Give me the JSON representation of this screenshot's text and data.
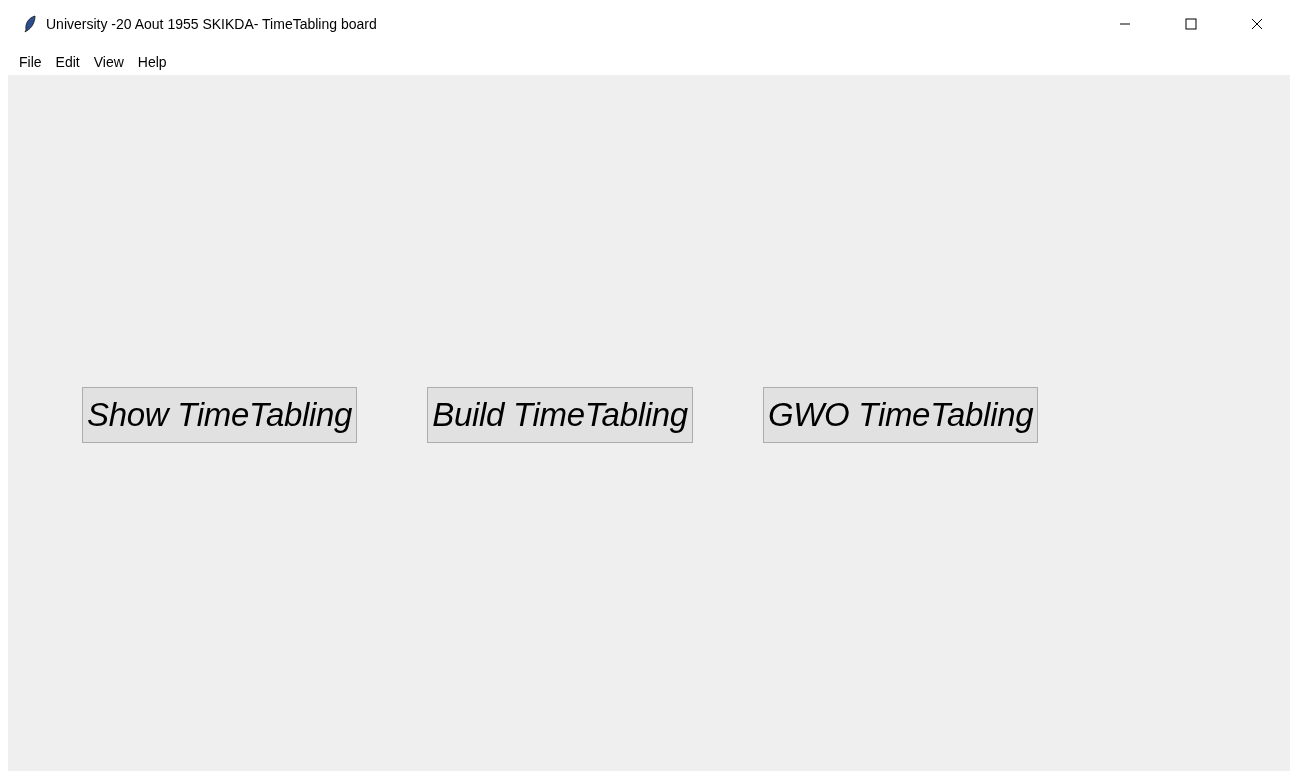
{
  "window": {
    "title": "University -20 Aout 1955 SKIKDA- TimeTabling board"
  },
  "menu": [
    "File",
    "Edit",
    "View",
    "Help"
  ],
  "buttons": [
    "Show TimeTabling",
    "Build TimeTabling",
    "GWO TimeTabling"
  ]
}
